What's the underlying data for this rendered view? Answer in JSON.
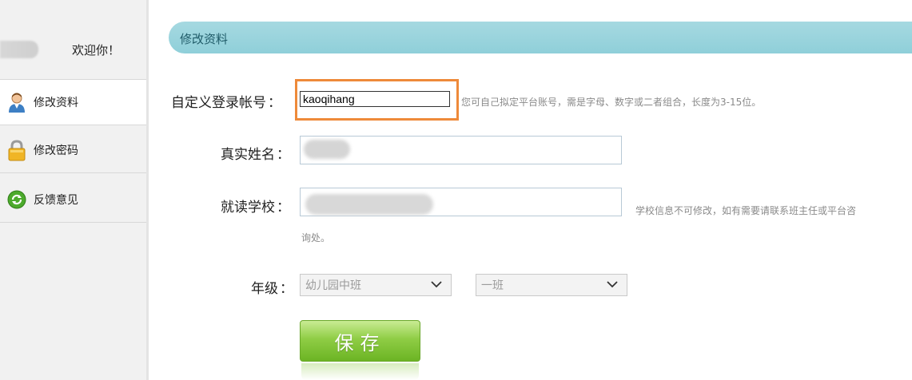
{
  "sidebar": {
    "welcome": "欢迎你！",
    "items": [
      {
        "label": "修改资料",
        "icon": "user-icon",
        "active": true
      },
      {
        "label": "修改密码",
        "icon": "lock-icon",
        "active": false
      },
      {
        "label": "反馈意见",
        "icon": "refresh-icon",
        "active": false
      }
    ]
  },
  "header": {
    "title": "修改资料"
  },
  "form": {
    "account": {
      "label": "自定义登录帐号",
      "colon": "：",
      "value": "kaoqihang",
      "hint": "您可自己拟定平台账号，需是字母、数字或二者组合，长度为3-15位。"
    },
    "realname": {
      "label": "真实姓名",
      "colon": "："
    },
    "school": {
      "label": "就读学校",
      "colon": "：",
      "hint_line1": "学校信息不可修改，如有需要请联系班主任或平台咨",
      "hint_line2": "询处。"
    },
    "grade": {
      "label": "年级",
      "colon": "：",
      "grade_value": "幼儿园中班",
      "class_value": "一班"
    },
    "save_label": "保存"
  },
  "colors": {
    "header_bar": "#9dd5de",
    "highlight_border": "#ee8a3a",
    "save_green": "#8fcd45"
  }
}
